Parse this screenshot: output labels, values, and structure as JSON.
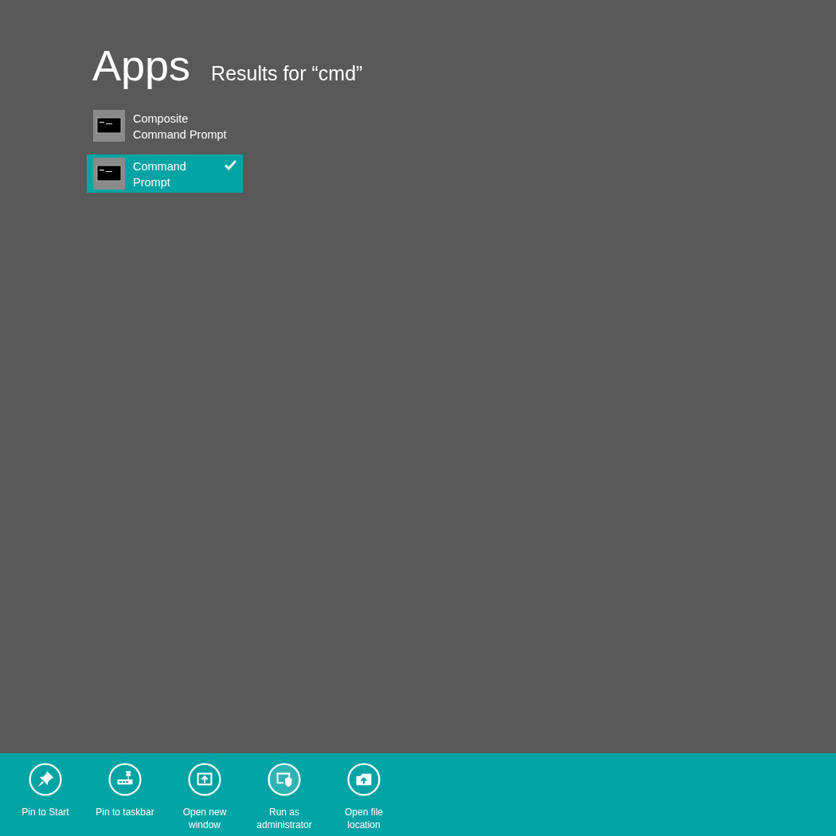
{
  "header": {
    "title": "Apps",
    "subtitle": "Results for “cmd”"
  },
  "results": [
    {
      "label": "Composite Command Prompt",
      "selected": false
    },
    {
      "label": "Command Prompt",
      "selected": true
    }
  ],
  "app_bar": {
    "commands": [
      {
        "kind": "pin",
        "label": "Pin to Start",
        "hovered": false
      },
      {
        "kind": "taskbar",
        "label": "Pin to taskbar",
        "hovered": false
      },
      {
        "kind": "window",
        "label": "Open new window",
        "hovered": false
      },
      {
        "kind": "admin",
        "label": "Run as administrator",
        "hovered": true
      },
      {
        "kind": "folder",
        "label": "Open file location",
        "hovered": false
      }
    ]
  }
}
